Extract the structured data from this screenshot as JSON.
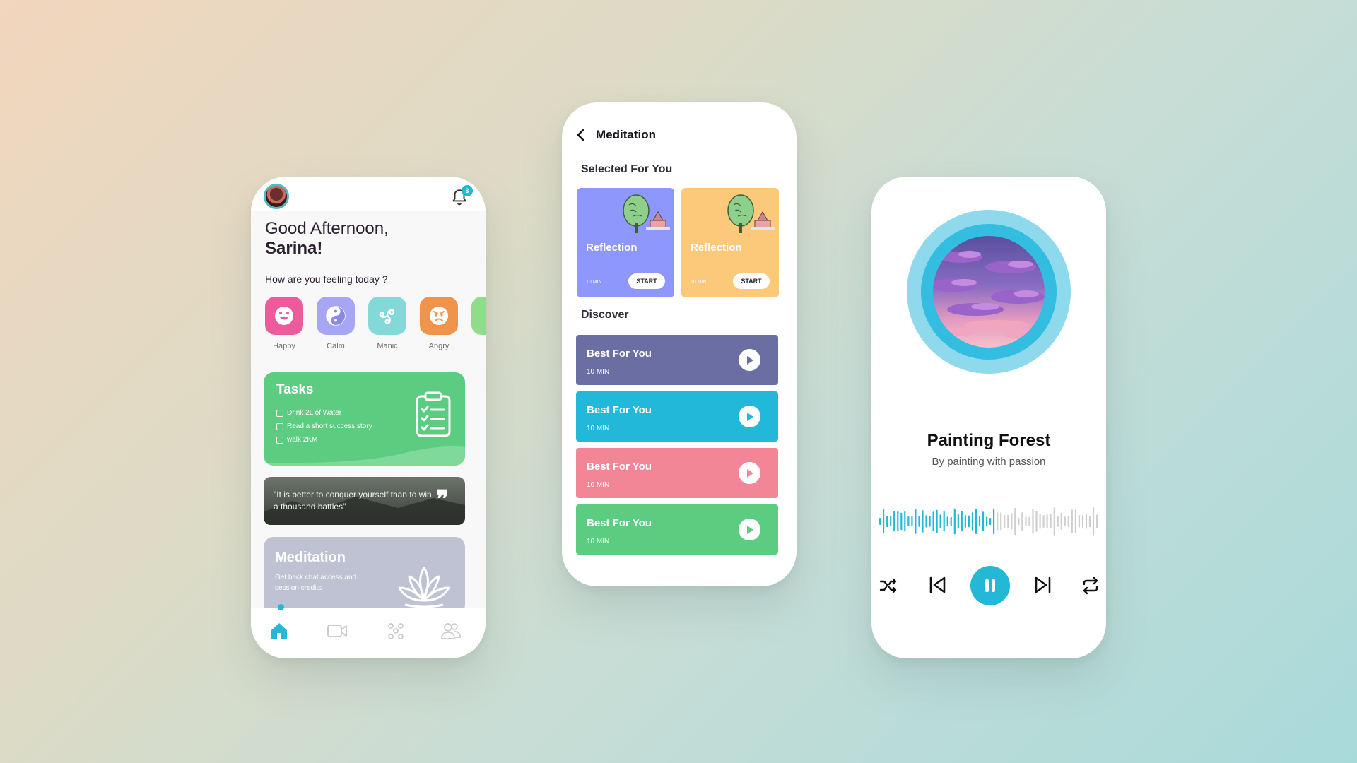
{
  "home": {
    "notification_count": "3",
    "greeting_line1": "Good Afternoon,",
    "greeting_name": "Sarina!",
    "feeling_question": "How are you feeling today ?",
    "moods": [
      {
        "label": "Happy",
        "icon": "smile-icon",
        "color": "#ee5b9c"
      },
      {
        "label": "Calm",
        "icon": "yin-yang-icon",
        "color": "#a7a6f4"
      },
      {
        "label": "Manic",
        "icon": "triskelion-icon",
        "color": "#83d9d8"
      },
      {
        "label": "Angry",
        "icon": "angry-face-icon",
        "color": "#f0944b"
      }
    ],
    "tasks": {
      "title": "Tasks",
      "items": [
        "Drink 2L of Water",
        "Read a short success story",
        "walk 2KM"
      ]
    },
    "quote": "\"It is better to conquer yourself than to win a thousand battles\"",
    "meditation": {
      "title": "Meditation",
      "subtitle": "Get back chat access and session credits"
    },
    "nav": [
      "home-icon",
      "video-icon",
      "community-icon",
      "group-icon"
    ]
  },
  "meditation_screen": {
    "title": "Meditation",
    "selected_heading": "Selected For You",
    "selected": [
      {
        "title": "Reflection",
        "duration": "10 MIN",
        "action": "START",
        "color": "#8e97fb"
      },
      {
        "title": "Reflection",
        "duration": "10 MIN",
        "action": "START",
        "color": "#fcc879"
      }
    ],
    "discover_heading": "Discover",
    "discover": [
      {
        "title": "Best For You",
        "duration": "10 MIN",
        "color": "#6b6ea3"
      },
      {
        "title": "Best For You",
        "duration": "10 MIN",
        "color": "#22b8d9"
      },
      {
        "title": "Best For You",
        "duration": "10 MIN",
        "color": "#f28596"
      },
      {
        "title": "Best For You",
        "duration": "10 MIN",
        "color": "#5ccc80"
      }
    ]
  },
  "player": {
    "song_title": "Painting Forest",
    "artist": "By painting with passion",
    "progress": 0.52,
    "accent": "#22b8d6",
    "controls": [
      "shuffle-icon",
      "previous-icon",
      "pause-icon",
      "next-icon",
      "repeat-icon"
    ]
  }
}
